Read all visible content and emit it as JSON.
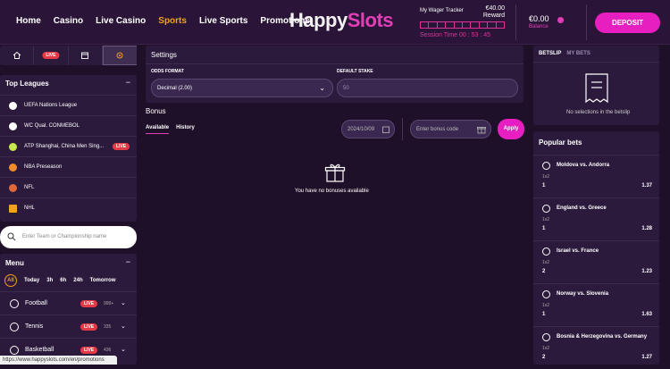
{
  "nav": {
    "items": [
      "Home",
      "Casino",
      "Live Casino",
      "Sports",
      "Live Sports",
      "Promotions"
    ],
    "active": "Sports"
  },
  "logo": {
    "part1": "Happy",
    "part2": "Slots"
  },
  "wager": {
    "title": "My Wager Tracker",
    "amount": "€40.00",
    "reward_label": "Reward",
    "session": "Session Time 00 : 53 : 45"
  },
  "balance": {
    "amount": "€0.00",
    "label": "Balance"
  },
  "deposit_label": "DEPOSIT",
  "quick_tabs": {
    "live_label": "LIVE"
  },
  "leagues": {
    "title": "Top Leagues",
    "items": [
      {
        "name": "UEFA Nations League",
        "icon": "soccer-icon",
        "color": "#ffffff",
        "live": ""
      },
      {
        "name": "WC Qual. CONMEBOL",
        "icon": "soccer-icon",
        "color": "#ffffff",
        "live": ""
      },
      {
        "name": "ATP Shanghai, China Men Sing...",
        "icon": "tennis-icon",
        "color": "#c5e84a",
        "live": "LIVE"
      },
      {
        "name": "NBA Preseason",
        "icon": "basketball-icon",
        "color": "#f08a2c",
        "live": ""
      },
      {
        "name": "NFL",
        "icon": "football-icon",
        "color": "#e0683a",
        "live": ""
      },
      {
        "name": "NHL",
        "icon": "hockey-icon",
        "color": "#f4a21a",
        "live": ""
      }
    ]
  },
  "search": {
    "placeholder": "Enter Team or Championship name"
  },
  "menu": {
    "title": "Menu",
    "filters": [
      "All",
      "Today",
      "3h",
      "6h",
      "24h",
      "Tomorrow"
    ],
    "sports": [
      {
        "name": "Football",
        "live": "LIVE",
        "count": "999+"
      },
      {
        "name": "Tennis",
        "live": "LIVE",
        "count": "335"
      },
      {
        "name": "Basketball",
        "live": "LIVE",
        "count": "436"
      }
    ]
  },
  "settings": {
    "title": "Settings",
    "odds_label": "ODDS FORMAT",
    "odds_value": "Decimal (2.00)",
    "stake_label": "DEFAULT STAKE",
    "stake_placeholder": "50"
  },
  "bonus": {
    "title": "Bonus",
    "tabs": [
      "Available",
      "History"
    ],
    "date": "2024/10/09",
    "code_placeholder": "Enter bonus code",
    "apply_label": "Apply",
    "empty": "You have no bonuses available"
  },
  "betslip": {
    "tab1": "BETSLIP",
    "tab2": "MY BETS",
    "empty": "No selections in the betslip"
  },
  "popular": {
    "title": "Popular bets",
    "items": [
      {
        "match": "Moldova vs. Andorra",
        "market": "1x2",
        "outcome": "1",
        "odds": "1.37"
      },
      {
        "match": "England vs. Greece",
        "market": "1x2",
        "outcome": "1",
        "odds": "1.28"
      },
      {
        "match": "Israel vs. France",
        "market": "1x2",
        "outcome": "2",
        "odds": "1.23"
      },
      {
        "match": "Norway vs. Slovenia",
        "market": "1x2",
        "outcome": "1",
        "odds": "1.63"
      },
      {
        "match": "Bosnia & Herzegovina vs. Germany",
        "market": "1x2",
        "outcome": "2",
        "odds": "1.27"
      }
    ]
  },
  "status_url": "https://www.happyslots.com/en/promotions",
  "colors": {
    "accent": "#e81fc0",
    "active_nav": "#f4a21a",
    "bg": "#1f1029",
    "panel": "#2c1a3d"
  }
}
